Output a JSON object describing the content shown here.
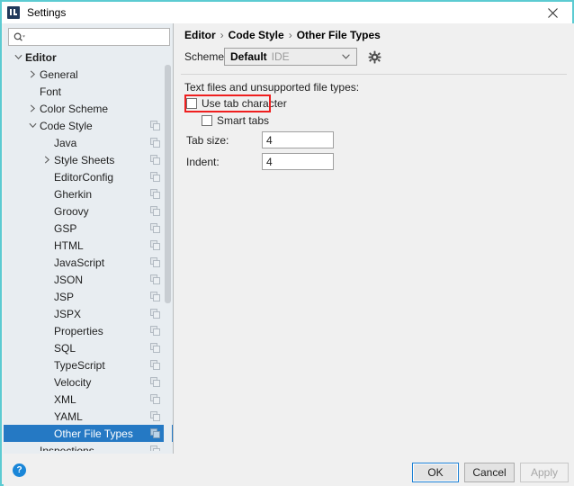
{
  "window": {
    "title": "Settings",
    "app_icon": "intellij-logo-icon",
    "close_icon": "close-icon",
    "border_color": "#5ccbd2"
  },
  "sidebar": {
    "search": {
      "placeholder": "",
      "value": "",
      "icon": "search-icon"
    },
    "row_icon": "copy-scheme-icon",
    "items": [
      {
        "label": "Editor",
        "indent": 0,
        "arrow": "down",
        "bold": true,
        "icon": false,
        "selected": false
      },
      {
        "label": "General",
        "indent": 1,
        "arrow": "right",
        "bold": false,
        "icon": false,
        "selected": false
      },
      {
        "label": "Font",
        "indent": 1,
        "arrow": "none",
        "bold": false,
        "icon": false,
        "selected": false
      },
      {
        "label": "Color Scheme",
        "indent": 1,
        "arrow": "right",
        "bold": false,
        "icon": false,
        "selected": false
      },
      {
        "label": "Code Style",
        "indent": 1,
        "arrow": "down",
        "bold": false,
        "icon": true,
        "selected": false
      },
      {
        "label": "Java",
        "indent": 2,
        "arrow": "none",
        "bold": false,
        "icon": true,
        "selected": false
      },
      {
        "label": "Style Sheets",
        "indent": 2,
        "arrow": "right",
        "bold": false,
        "icon": true,
        "selected": false
      },
      {
        "label": "EditorConfig",
        "indent": 2,
        "arrow": "none",
        "bold": false,
        "icon": true,
        "selected": false
      },
      {
        "label": "Gherkin",
        "indent": 2,
        "arrow": "none",
        "bold": false,
        "icon": true,
        "selected": false
      },
      {
        "label": "Groovy",
        "indent": 2,
        "arrow": "none",
        "bold": false,
        "icon": true,
        "selected": false
      },
      {
        "label": "GSP",
        "indent": 2,
        "arrow": "none",
        "bold": false,
        "icon": true,
        "selected": false
      },
      {
        "label": "HTML",
        "indent": 2,
        "arrow": "none",
        "bold": false,
        "icon": true,
        "selected": false
      },
      {
        "label": "JavaScript",
        "indent": 2,
        "arrow": "none",
        "bold": false,
        "icon": true,
        "selected": false
      },
      {
        "label": "JSON",
        "indent": 2,
        "arrow": "none",
        "bold": false,
        "icon": true,
        "selected": false
      },
      {
        "label": "JSP",
        "indent": 2,
        "arrow": "none",
        "bold": false,
        "icon": true,
        "selected": false
      },
      {
        "label": "JSPX",
        "indent": 2,
        "arrow": "none",
        "bold": false,
        "icon": true,
        "selected": false
      },
      {
        "label": "Properties",
        "indent": 2,
        "arrow": "none",
        "bold": false,
        "icon": true,
        "selected": false
      },
      {
        "label": "SQL",
        "indent": 2,
        "arrow": "none",
        "bold": false,
        "icon": true,
        "selected": false
      },
      {
        "label": "TypeScript",
        "indent": 2,
        "arrow": "none",
        "bold": false,
        "icon": true,
        "selected": false
      },
      {
        "label": "Velocity",
        "indent": 2,
        "arrow": "none",
        "bold": false,
        "icon": true,
        "selected": false
      },
      {
        "label": "XML",
        "indent": 2,
        "arrow": "none",
        "bold": false,
        "icon": true,
        "selected": false
      },
      {
        "label": "YAML",
        "indent": 2,
        "arrow": "none",
        "bold": false,
        "icon": true,
        "selected": false
      },
      {
        "label": "Other File Types",
        "indent": 2,
        "arrow": "none",
        "bold": false,
        "icon": true,
        "selected": true
      },
      {
        "label": "Inspections",
        "indent": 1,
        "arrow": "none",
        "bold": false,
        "icon": true,
        "selected": false
      }
    ],
    "selection_color": "#2579c4"
  },
  "main": {
    "breadcrumb": {
      "items": [
        "Editor",
        "Code Style",
        "Other File Types"
      ],
      "separator": "›"
    },
    "scheme": {
      "label": "Scheme:",
      "value": "Default",
      "scope": "IDE",
      "dropdown_icon": "chevron-down-icon",
      "gear_icon": "gear-icon"
    },
    "section_label": "Text files and unsupported file types:",
    "checkboxes": [
      {
        "label": "Use tab character",
        "checked": false,
        "highlighted": true
      },
      {
        "label": "Smart tabs",
        "checked": false,
        "highlighted": false
      }
    ],
    "fields": [
      {
        "label": "Tab size:",
        "value": "4"
      },
      {
        "label": "Indent:",
        "value": "4"
      }
    ],
    "highlight_color": "#ef1f1f"
  },
  "footer": {
    "help_icon": "help-icon",
    "help_glyph": "?",
    "buttons": [
      {
        "label": "OK",
        "state": "default"
      },
      {
        "label": "Cancel",
        "state": "normal"
      },
      {
        "label": "Apply",
        "state": "disabled"
      }
    ]
  }
}
